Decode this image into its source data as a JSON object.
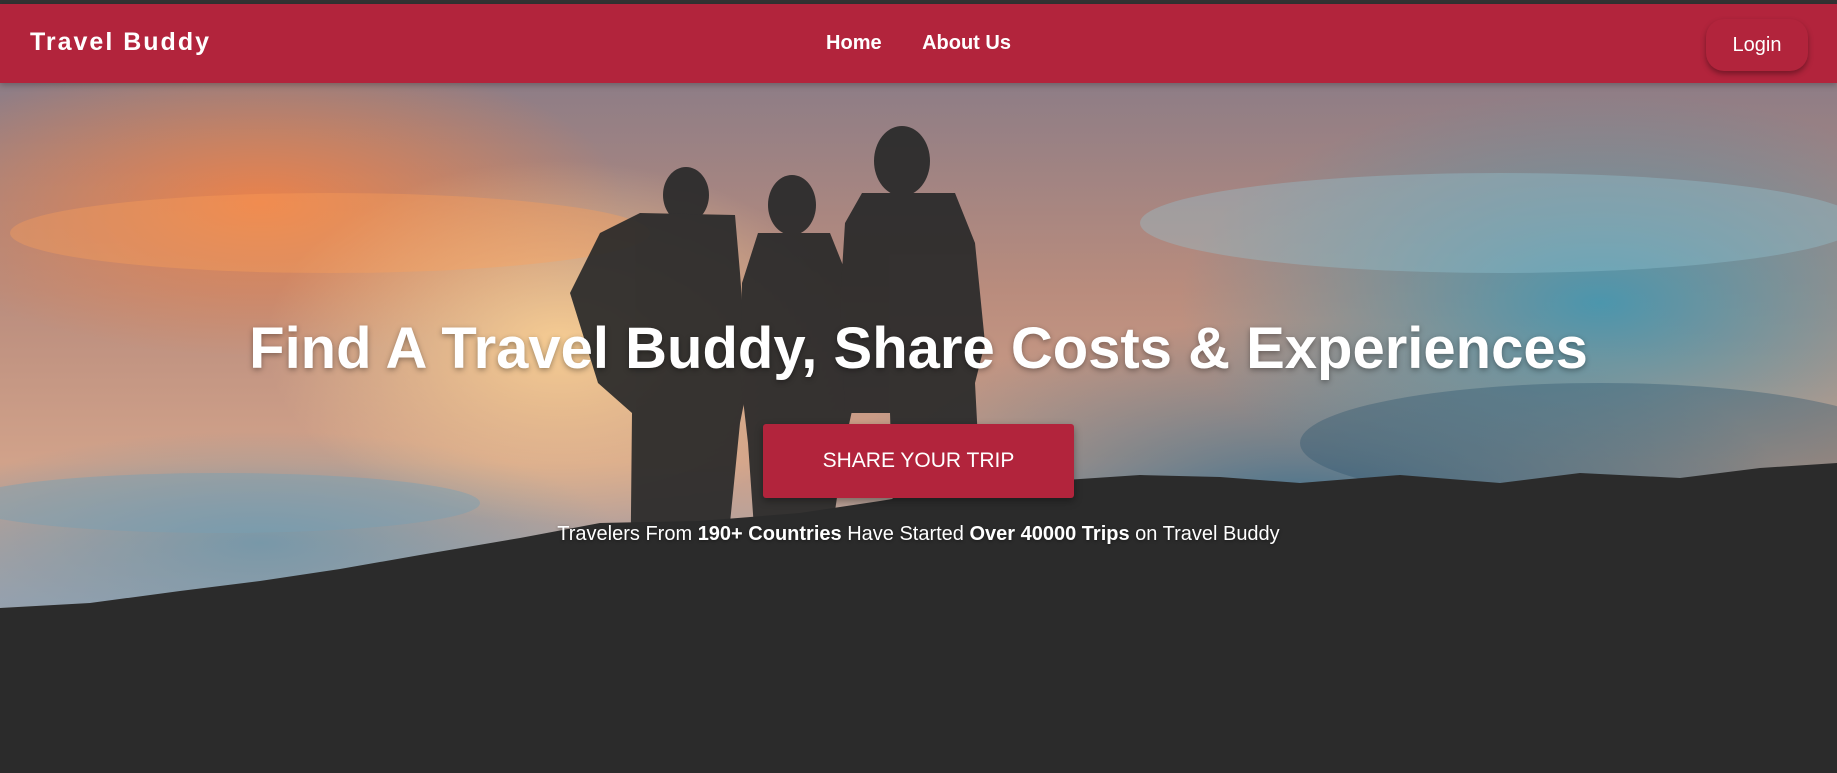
{
  "navbar": {
    "brand": "Travel Buddy",
    "links": [
      "Home",
      "About Us"
    ],
    "login_label": "Login"
  },
  "hero": {
    "headline": "Find A Travel Buddy, Share Costs & Experiences",
    "cta_label": "SHARE YOUR TRIP",
    "stats": {
      "prefix": "Travelers From ",
      "countries": "190+ Countries",
      "middle": " Have Started ",
      "trips": "Over 40000 Trips",
      "suffix": " on Travel Buddy"
    }
  },
  "colors": {
    "brand": "#b2243c",
    "silhouette": "#2b2b2b",
    "text": "#ffffff"
  }
}
